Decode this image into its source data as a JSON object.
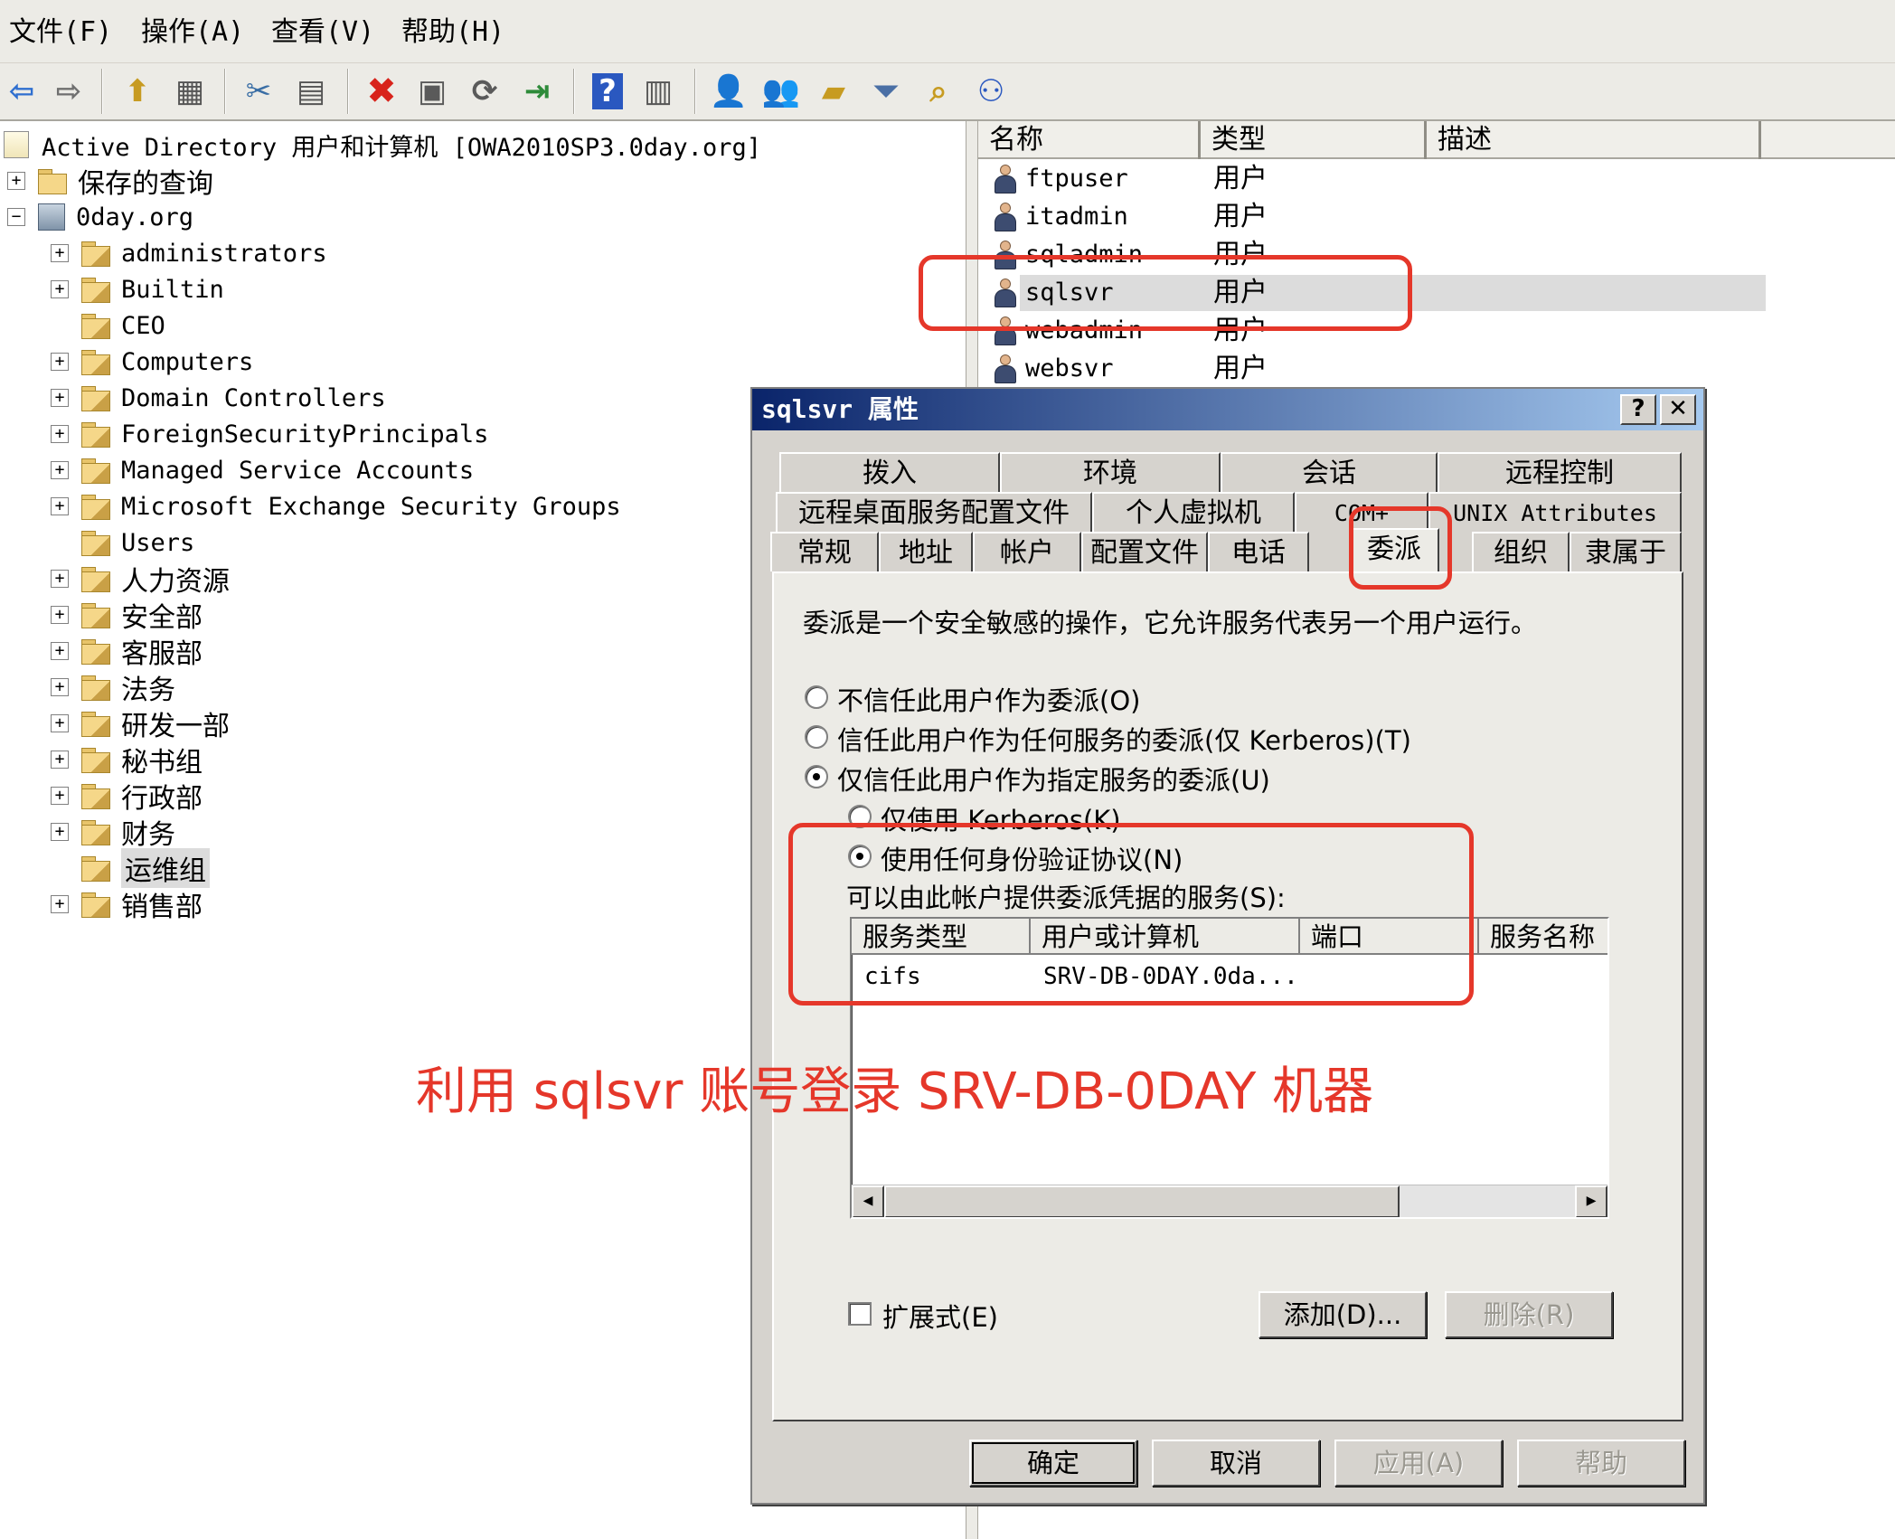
{
  "menu": [
    "文件(F)",
    "操作(A)",
    "查看(V)",
    "帮助(H)"
  ],
  "toolbar": {
    "buttons": [
      "back-icon",
      "forward-icon",
      "up-folder-icon",
      "show-hide-tree-icon",
      "cut-icon",
      "paste-icon",
      "delete-icon",
      "properties-icon",
      "refresh-icon",
      "export-list-icon",
      "help-icon",
      "console-tree-icon",
      "new-user-icon",
      "new-group-icon",
      "new-ou-icon",
      "filter-icon",
      "find-icon",
      "add-to-group-icon"
    ]
  },
  "tree": {
    "root": "Active Directory 用户和计算机 [OWA2010SP3.0day.org]",
    "saved_queries": "保存的查询",
    "domain": "0day.org",
    "items": [
      {
        "label": "administrators",
        "expandable": true
      },
      {
        "label": "Builtin",
        "expandable": true
      },
      {
        "label": "CEO",
        "expandable": false
      },
      {
        "label": "Computers",
        "expandable": true
      },
      {
        "label": "Domain Controllers",
        "expandable": true
      },
      {
        "label": "ForeignSecurityPrincipals",
        "expandable": true
      },
      {
        "label": "Managed Service Accounts",
        "expandable": true
      },
      {
        "label": "Microsoft Exchange Security Groups",
        "expandable": true
      },
      {
        "label": "Users",
        "expandable": false
      },
      {
        "label": "人力资源",
        "expandable": true
      },
      {
        "label": "安全部",
        "expandable": true
      },
      {
        "label": "客服部",
        "expandable": true
      },
      {
        "label": "法务",
        "expandable": true
      },
      {
        "label": "研发一部",
        "expandable": true
      },
      {
        "label": "秘书组",
        "expandable": true
      },
      {
        "label": "行政部",
        "expandable": true
      },
      {
        "label": "财务",
        "expandable": true
      },
      {
        "label": "运维组",
        "expandable": false,
        "selected": true
      },
      {
        "label": "销售部",
        "expandable": true
      }
    ]
  },
  "list": {
    "columns": [
      "名称",
      "类型",
      "描述"
    ],
    "rows": [
      {
        "name": "ftpuser",
        "type": "用户"
      },
      {
        "name": "itadmin",
        "type": "用户"
      },
      {
        "name": "sqladmin",
        "type": "用户"
      },
      {
        "name": "sqlsvr",
        "type": "用户",
        "selected": true
      },
      {
        "name": "webadmin",
        "type": "用户"
      },
      {
        "name": "websvr",
        "type": "用户"
      }
    ]
  },
  "dialog": {
    "title": "sqlsvr 属性",
    "help_btn": "?",
    "close_btn": "✕",
    "tabs_row1": [
      "拨入",
      "环境",
      "会话",
      "远程控制"
    ],
    "tabs_row2": [
      "远程桌面服务配置文件",
      "个人虚拟机",
      "COM+",
      "UNIX Attributes"
    ],
    "tabs_row3": [
      "常规",
      "地址",
      "帐户",
      "配置文件",
      "电话",
      "委派",
      "组织",
      "隶属于"
    ],
    "active_tab": "委派",
    "description": "委派是一个安全敏感的操作，它允许服务代表另一个用户运行。",
    "options": [
      {
        "label": "不信任此用户作为委派(O)",
        "checked": false
      },
      {
        "label": "信任此用户作为任何服务的委派(仅 Kerberos)(T)",
        "checked": false
      },
      {
        "label": "仅信任此用户作为指定服务的委派(U)",
        "checked": true
      }
    ],
    "sub_options": [
      {
        "label": "仅使用 Kerberos(K)",
        "checked": false
      },
      {
        "label": "使用任何身份验证协议(N)",
        "checked": true
      }
    ],
    "services_label": "可以由此帐户提供委派凭据的服务(S):",
    "service_columns": [
      "服务类型",
      "用户或计算机",
      "端口",
      "服务名称"
    ],
    "services": [
      {
        "type": "cifs",
        "host": "SRV-DB-0DAY.0da..."
      }
    ],
    "expanded_label": "扩展式(E)",
    "add_button": "添加(D)...",
    "remove_button": "删除(R)",
    "ok_button": "确定",
    "cancel_button": "取消",
    "apply_button": "应用(A)",
    "help_button": "帮助"
  },
  "annotation": {
    "text": "利用 sqlsvr 账号登录 SRV-DB-0DAY 机器",
    "color": "#e5372a"
  }
}
